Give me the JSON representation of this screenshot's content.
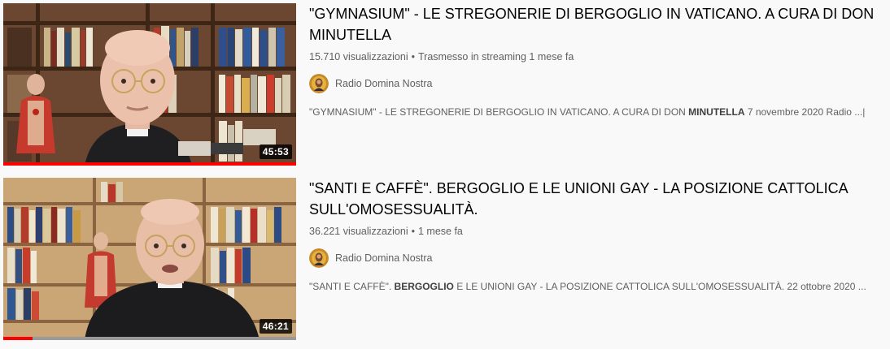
{
  "videos": [
    {
      "title": "\"GYMNASIUM\" - LE STREGONERIE DI BERGOGLIO IN VATICANO. A CURA DI DON MINUTELLA",
      "views": "15.710 visualizzazioni",
      "stream_label": "Trasmesso in streaming",
      "age": "1 mese fa",
      "channel": "Radio Domina Nostra",
      "description_parts": [
        "\"GYMNASIUM\" - LE STREGONERIE DI BERGOGLIO IN VATICANO. A CURA DI DON ",
        "MINUTELLA",
        " 7 novembre 2020 Radio ...|"
      ],
      "duration": "45:53",
      "watched_fraction": 1.0
    },
    {
      "title": "\"SANTI E CAFFÈ\". BERGOGLIO E LE UNIONI GAY - LA POSIZIONE CATTOLICA SULL'OMOSESSUALITÀ.",
      "views": "36.221 visualizzazioni",
      "stream_label": "",
      "age": "1 mese fa",
      "channel": "Radio Domina Nostra",
      "description_parts": [
        "\"SANTI E CAFFÈ\". ",
        "BERGOGLIO",
        " E LE UNIONI GAY - LA POSIZIONE CATTOLICA SULL'OMOSESSUALITÀ. 22 ottobre 2020 ..."
      ],
      "duration": "46:21",
      "watched_fraction": 0.1
    }
  ],
  "colors": {
    "progress": "#ff0000",
    "text_primary": "#030303",
    "text_secondary": "#606060"
  }
}
